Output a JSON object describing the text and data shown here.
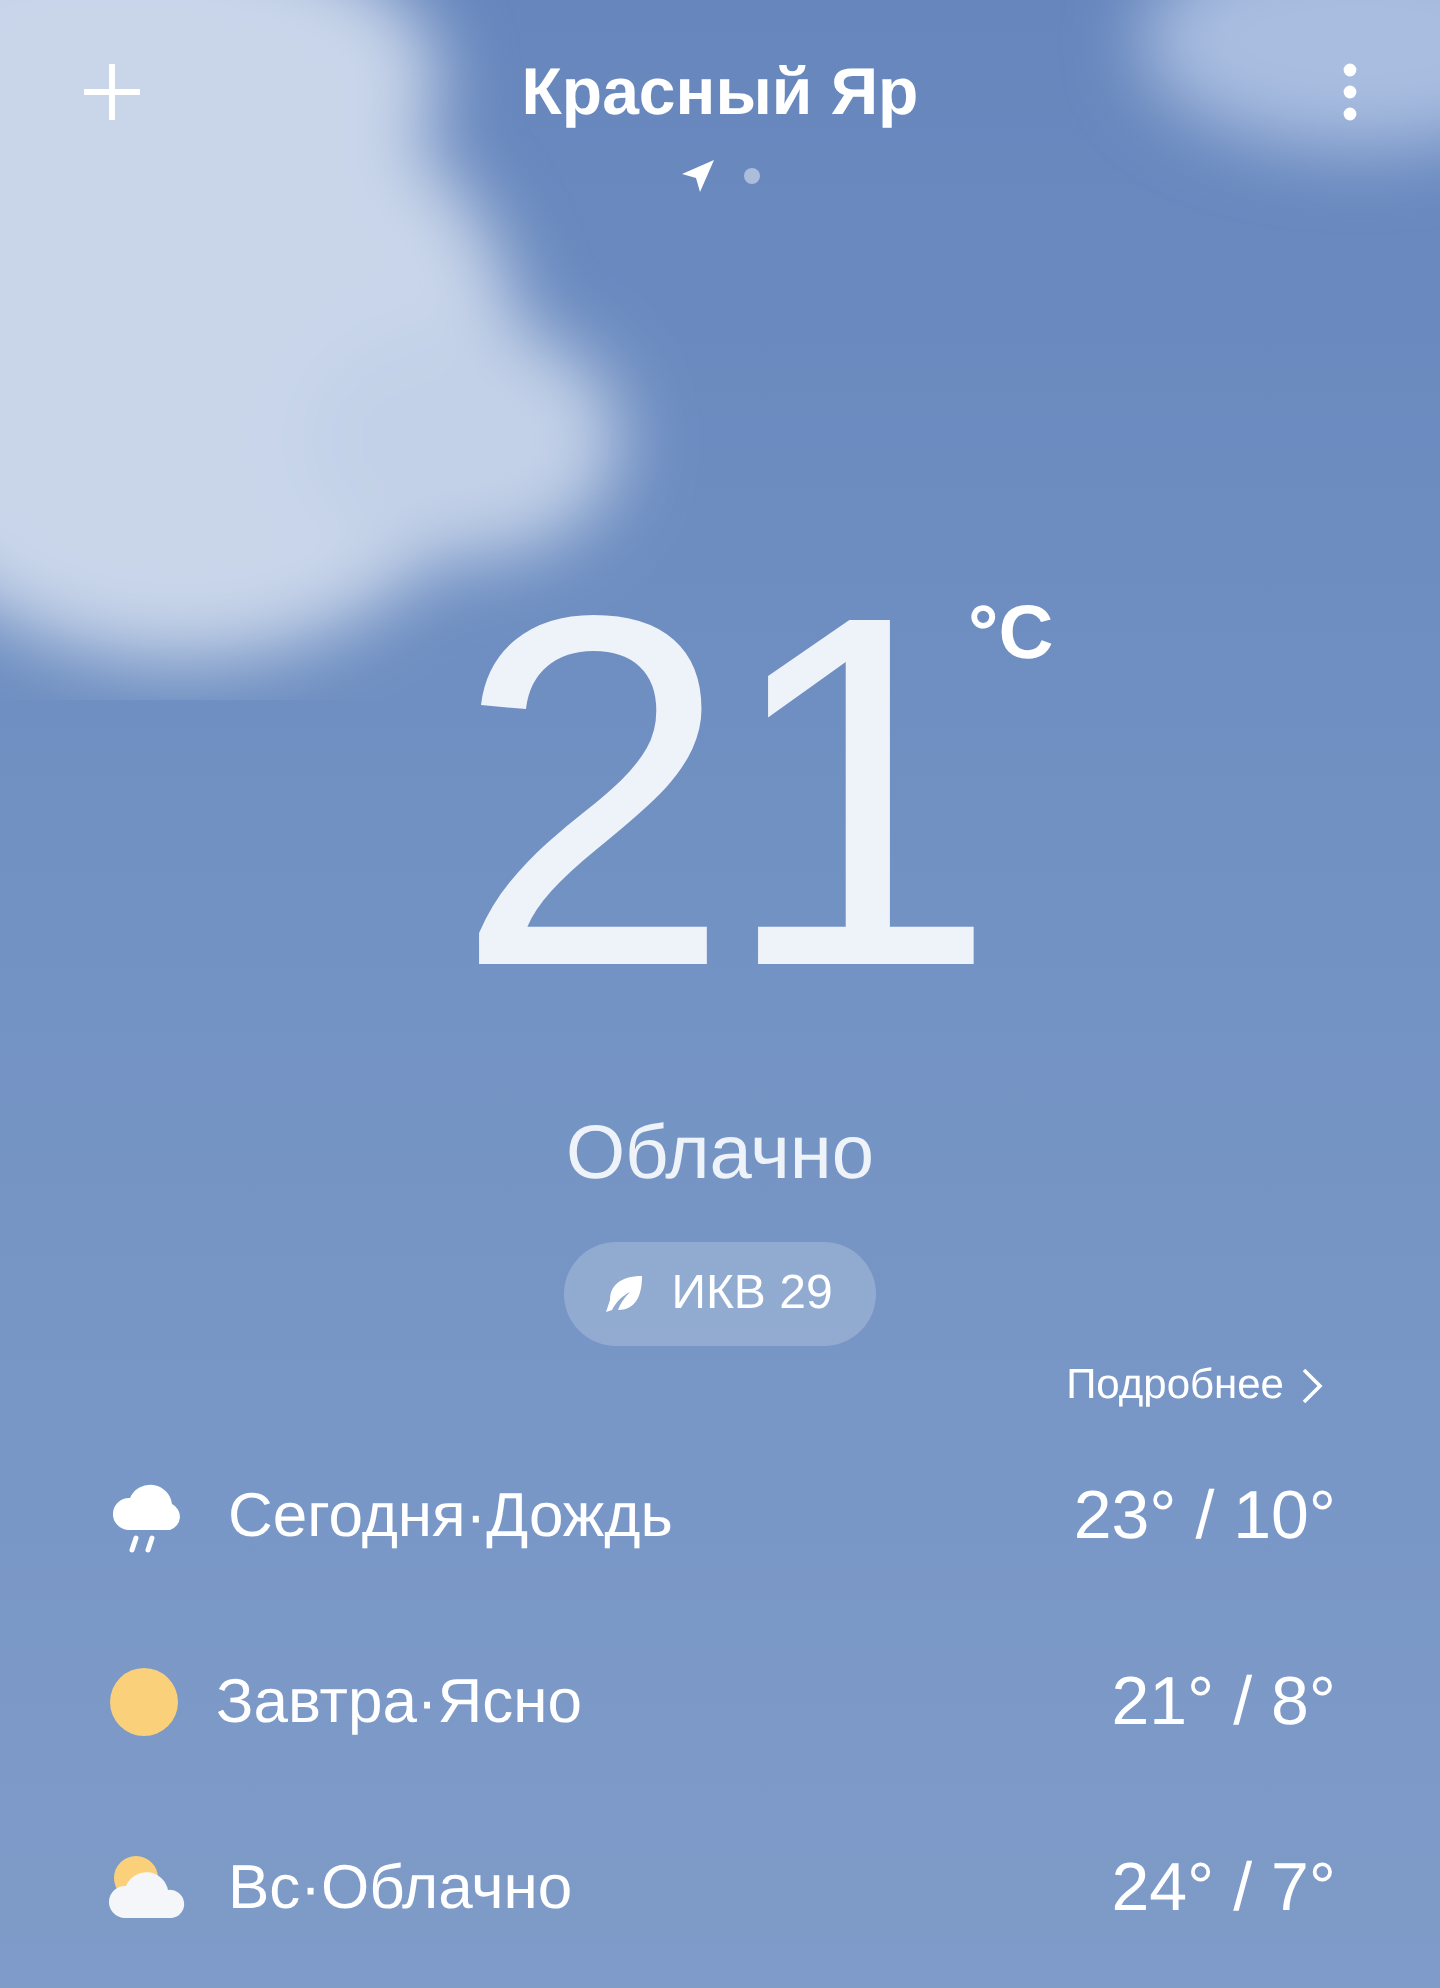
{
  "header": {
    "title": "Красный Яр",
    "pages": [
      {
        "kind": "location",
        "selected": true
      },
      {
        "kind": "dot",
        "selected": false
      }
    ]
  },
  "current": {
    "temperature": "21",
    "unit": "°C",
    "condition": "Облачно",
    "aqi": "ИКВ 29"
  },
  "details_link": "Подробнее",
  "forecast": [
    {
      "kind": "rain",
      "label": "Сегодня·Дождь",
      "range": "23° / 10°"
    },
    {
      "kind": "sun",
      "label": "Завтра·Ясно",
      "range": "21° / 8°"
    },
    {
      "kind": "partly_cloudy",
      "label": "Вс·Облачно",
      "range": "24° / 7°"
    }
  ]
}
